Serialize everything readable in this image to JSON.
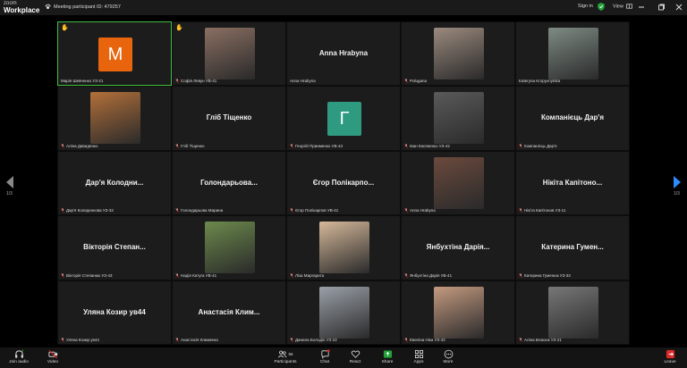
{
  "app": {
    "brand_small": "zoom",
    "brand_big": "Workplace",
    "meeting_id": "Meeting participant ID: 479257"
  },
  "topbar": {
    "signin": "Sign in",
    "view": "View"
  },
  "pager": {
    "left": "1/3",
    "right": "1/3"
  },
  "tiles": [
    {
      "name": "Марія Шевченко УЗ-21",
      "big": "",
      "avatar_letter": "M",
      "avatar_color": "#e8650e",
      "hand": true,
      "active": true,
      "muted": false
    },
    {
      "name": "Софія Левун УВ-41",
      "big": "",
      "photo": "#8a6f62",
      "hand": true,
      "muted": true
    },
    {
      "name": "Anna Hrabyna",
      "big": "Anna Hrabyna",
      "muted": false
    },
    {
      "name": "Polugana",
      "big": "",
      "photo": "#9b8a7e",
      "muted": true
    },
    {
      "name": "Kateryna Kropyvnytska",
      "big": "",
      "photo": "#7e8b84",
      "muted": false
    },
    {
      "name": "Аліна Давиденко",
      "big": "",
      "photo": "#b3703a",
      "muted": true
    },
    {
      "name": "Гліб Тіщенко",
      "big": "Гліб Тіщенко",
      "muted": true
    },
    {
      "name": "Георгій Приименко УВ-43",
      "big": "",
      "avatar_letter": "Г",
      "avatar_color": "#2e9a80",
      "muted": true
    },
    {
      "name": "Іван Касяненко УЗ-42",
      "big": "",
      "photo": "#5a5a5a",
      "muted": true
    },
    {
      "name": "Компанієць Дар'я",
      "big": "Компанієць Дар'я",
      "muted": true
    },
    {
      "name": "Дар'я Коледенкова УЗ-32",
      "big": "Дар'я Колодни...",
      "muted": true
    },
    {
      "name": "Голондарьова Марина",
      "big": "Голондарьова...",
      "muted": true
    },
    {
      "name": "Єгор Полікарпов УВ-41",
      "big": "Єгор Полікарпо...",
      "muted": true
    },
    {
      "name": "Anna Hrabyna",
      "big": "",
      "photo": "#6b4a3d",
      "muted": true
    },
    {
      "name": "Нікіта Капітонов УЗ-11",
      "big": "Нікіта Капітоно...",
      "muted": true
    },
    {
      "name": "Вікторія Степанюк УЗ-43",
      "big": "Вікторія Степан...",
      "muted": true
    },
    {
      "name": "Надія Катуга УВ-41",
      "big": "",
      "photo": "#6c8a4c",
      "muted": true
    },
    {
      "name": "Ліза Маргарита",
      "big": "",
      "photo": "#d5b89a",
      "muted": true
    },
    {
      "name": "Янбухтіна Дарія УВ-41",
      "big": "Янбухтіна Дарія...",
      "muted": true
    },
    {
      "name": "Катерина Гуменюк УЗ-33",
      "big": "Катерина Гумен...",
      "muted": true
    },
    {
      "name": "Уляна Козир ув44",
      "big": "Уляна Козир ув44",
      "muted": true
    },
    {
      "name": "Анастасія Клименко",
      "big": "Анастасія Клим...",
      "muted": true
    },
    {
      "name": "Данила Болодін УЗ-22",
      "big": "",
      "photo": "#9aa0a8",
      "muted": true
    },
    {
      "name": "Евеліна Ніка УЗ-43",
      "big": "",
      "photo": "#c49a80",
      "muted": true
    },
    {
      "name": "Аліна Власюк УЗ-21",
      "big": "",
      "photo": "#777777",
      "muted": true
    }
  ],
  "toolbar": {
    "join_audio": "Join audio",
    "video": "Video",
    "participants": "Participants",
    "participants_count": "56",
    "chat": "Chat",
    "react": "React",
    "share": "Share",
    "apps": "Apps",
    "more": "More",
    "leave": "Leave"
  }
}
